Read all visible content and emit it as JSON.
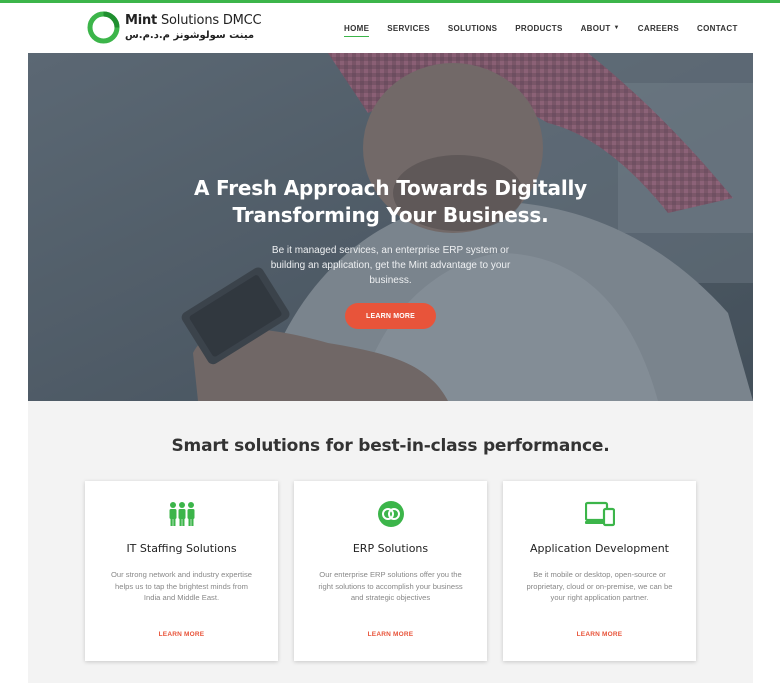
{
  "brand": {
    "name_bold": "Mint",
    "name_light": " Solutions DMCC",
    "arabic": "مينت سولوشونز م.د.م.س",
    "accent_color": "#3cb54a"
  },
  "nav": {
    "items": [
      {
        "label": "HOME",
        "active": true
      },
      {
        "label": "SERVICES"
      },
      {
        "label": "SOLUTIONS"
      },
      {
        "label": "PRODUCTS"
      },
      {
        "label": "ABOUT",
        "dropdown": true
      },
      {
        "label": "CAREERS"
      },
      {
        "label": "CONTACT"
      }
    ]
  },
  "hero": {
    "title_line1": "A Fresh Approach Towards Digitally",
    "title_line2": "Transforming Your Business.",
    "subtitle": "Be it managed services, an enterprise ERP system or building an application, get the Mint advantage to your business.",
    "button_label": "LEARN MORE",
    "button_color": "#e8543a"
  },
  "solutions": {
    "heading": "Smart solutions for best-in-class performance.",
    "cards": [
      {
        "icon": "people-icon",
        "title": "IT Staffing Solutions",
        "text": "Our strong network and industry expertise helps us to tap the brightest minds from India and Middle East.",
        "link": "LEARN MORE"
      },
      {
        "icon": "erp-rings-icon",
        "title": "ERP Solutions",
        "text": "Our enterprise ERP solutions offer you the right solutions to accomplish your business and strategic objectives",
        "link": "LEARN MORE"
      },
      {
        "icon": "devices-icon",
        "title": "Application Development",
        "text": "Be it mobile or desktop, open-source or proprietary, cloud or on-premise, we can be your right application partner.",
        "link": "LEARN MORE"
      }
    ]
  }
}
